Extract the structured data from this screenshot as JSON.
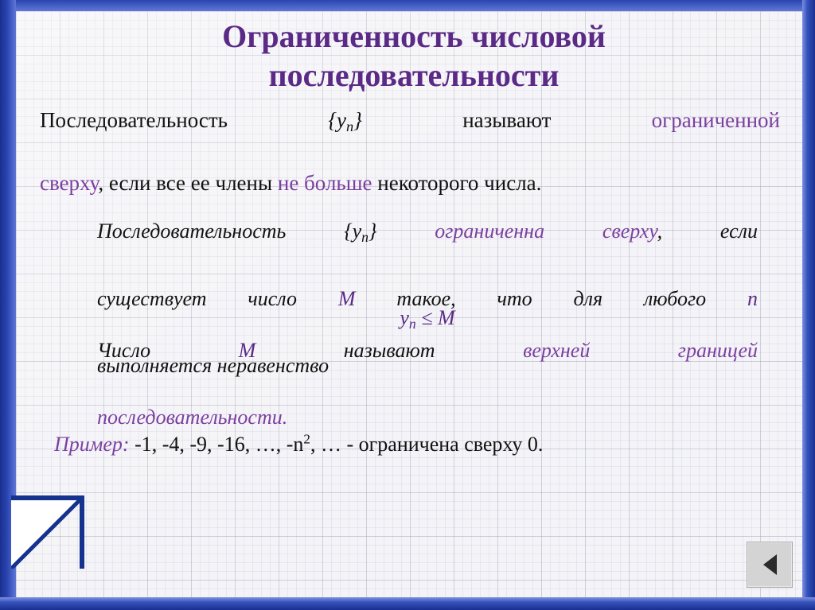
{
  "slide": {
    "title_line1": "Ограниченность числовой",
    "title_line2": "последовательности",
    "title_color": "#5b2a86"
  },
  "definition_intro": {
    "line1_part1": "Последовательность",
    "line1_seq": "{y",
    "line1_seq_sub": "n",
    "line1_seq_close": "}",
    "line1_part2": "называют",
    "line1_highlight": "ограниченной",
    "line2_highlight": "сверху",
    "line2_part1": ", если все ее члены",
    "line2_highlight2": "не больше",
    "line2_part2": "некоторого числа."
  },
  "definition_main": {
    "l1_a": "Последовательность",
    "l1_seq": "{y",
    "l1_seq_sub": "n",
    "l1_seq_close": "}",
    "l1_hl": "ограниченна сверху",
    "l1_b": ", если",
    "l2_a": "существует  число",
    "l2_M": "М",
    "l2_b": "такое,  что  для  любого",
    "l2_n": "n",
    "l3": "выполняется неравенство",
    "formula_y": "y",
    "formula_sub": "n",
    "formula_rest": " ≤ M",
    "l4_a": "Число",
    "l4_M": "М",
    "l4_b": "называют",
    "l4_hl": "верхней    границей",
    "l5_hl": "последовательности."
  },
  "example": {
    "label": "Пример:",
    "values": "-1, -4, -9, -16, …, -n",
    "power": "2",
    "tail": ", … - ограничена сверху 0."
  },
  "nav": {
    "prev_icon": "triangle-left-icon"
  },
  "colors": {
    "accent_purple": "#7b3fa0",
    "title_purple": "#5b2a86",
    "frame_blue": "#1a2f8f"
  }
}
